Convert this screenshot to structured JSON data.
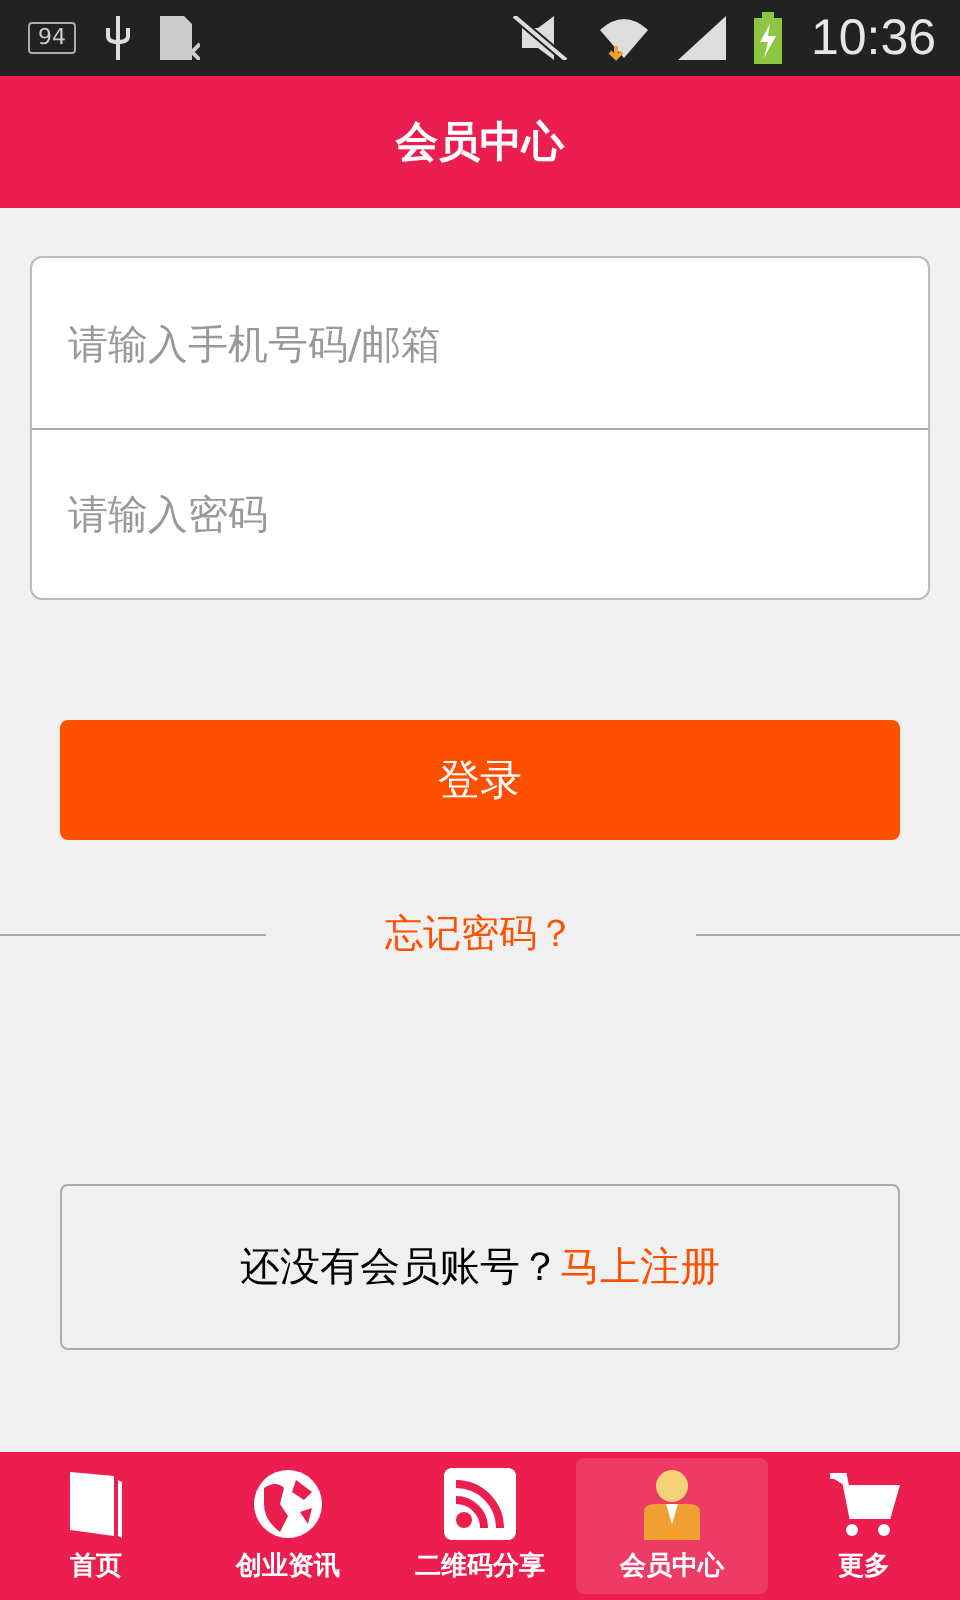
{
  "status_bar": {
    "battery_badge": "94",
    "time": "10:36"
  },
  "header": {
    "title": "会员中心"
  },
  "form": {
    "fields": [
      {
        "placeholder": "请输入手机号码/邮箱"
      },
      {
        "placeholder": "请输入密码"
      }
    ],
    "submit": "登录",
    "forgot": "忘记密码？"
  },
  "register": {
    "text": "还没有会员账号？",
    "link": "马上注册"
  },
  "tabs": [
    {
      "label": "首页",
      "kind": "book",
      "selected": false
    },
    {
      "label": "创业资讯",
      "kind": "globe",
      "selected": false
    },
    {
      "label": "二维码分享",
      "kind": "rss",
      "selected": false
    },
    {
      "label": "会员中心",
      "kind": "member",
      "selected": true
    },
    {
      "label": "更多",
      "kind": "cart",
      "selected": false
    }
  ]
}
